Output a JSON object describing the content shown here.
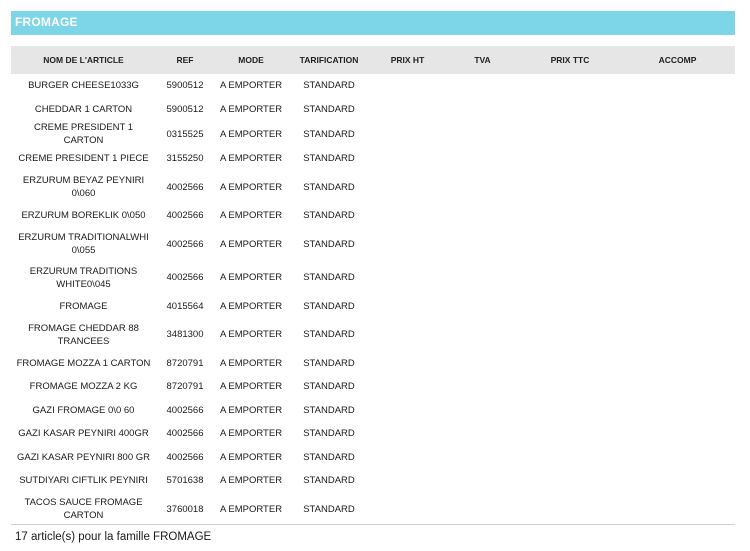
{
  "family": {
    "title": "FROMAGE"
  },
  "table": {
    "columns": [
      "NOM DE L'ARTICLE",
      "REF",
      "MODE",
      "TARIFICATION",
      "PRIX HT",
      "TVA",
      "PRIX TTC",
      "ACCOMP"
    ],
    "rows": [
      [
        "BURGER CHEESE1033G",
        "5900512",
        "A EMPORTER",
        "STANDARD",
        "",
        "",
        "",
        ""
      ],
      [
        "CHEDDAR 1 CARTON",
        "5900512",
        "A EMPORTER",
        "STANDARD",
        "",
        "",
        "",
        ""
      ],
      [
        "CREME PRESIDENT 1 CARTON",
        "0315525",
        "A EMPORTER",
        "STANDARD",
        "",
        "",
        "",
        ""
      ],
      [
        "CREME PRESIDENT 1 PIECE",
        "3155250",
        "A EMPORTER",
        "STANDARD",
        "",
        "",
        "",
        ""
      ],
      [
        "ERZURUM BEYAZ PEYNIRI 0\\060",
        "4002566",
        "A EMPORTER",
        "STANDARD",
        "",
        "",
        "",
        ""
      ],
      [
        "ERZURUM BOREKLIK 0\\050",
        "4002566",
        "A EMPORTER",
        "STANDARD",
        "",
        "",
        "",
        ""
      ],
      [
        "ERZURUM TRADITIONALWHI 0\\055",
        "4002566",
        "A EMPORTER",
        "STANDARD",
        "",
        "",
        "",
        ""
      ],
      [
        "ERZURUM TRADITIONS WHITE0\\045",
        "4002566",
        "A EMPORTER",
        "STANDARD",
        "",
        "",
        "",
        ""
      ],
      [
        "FROMAGE",
        "4015564",
        "A EMPORTER",
        "STANDARD",
        "",
        "",
        "",
        ""
      ],
      [
        "FROMAGE CHEDDAR 88 TRANCEES",
        "3481300",
        "A EMPORTER",
        "STANDARD",
        "",
        "",
        "",
        ""
      ],
      [
        "FROMAGE MOZZA 1 CARTON",
        "8720791",
        "A EMPORTER",
        "STANDARD",
        "",
        "",
        "",
        ""
      ],
      [
        "FROMAGE MOZZA 2 KG",
        "8720791",
        "A EMPORTER",
        "STANDARD",
        "",
        "",
        "",
        ""
      ],
      [
        "GAZI FROMAGE 0\\0 60",
        "4002566",
        "A EMPORTER",
        "STANDARD",
        "",
        "",
        "",
        ""
      ],
      [
        "GAZI KASAR PEYNIRI 400GR",
        "4002566",
        "A EMPORTER",
        "STANDARD",
        "",
        "",
        "",
        ""
      ],
      [
        "GAZI KASAR PEYNIRI 800 GR",
        "4002566",
        "A EMPORTER",
        "STANDARD",
        "",
        "",
        "",
        ""
      ],
      [
        "SUTDIYARI CIFTLIK PEYNIRI",
        "5701638",
        "A EMPORTER",
        "STANDARD",
        "",
        "",
        "",
        ""
      ],
      [
        "TACOS SAUCE FROMAGE CARTON",
        "3760018",
        "A EMPORTER",
        "STANDARD",
        "",
        "",
        "",
        ""
      ]
    ]
  },
  "footer": {
    "summary": "17 article(s) pour la famille FROMAGE"
  }
}
